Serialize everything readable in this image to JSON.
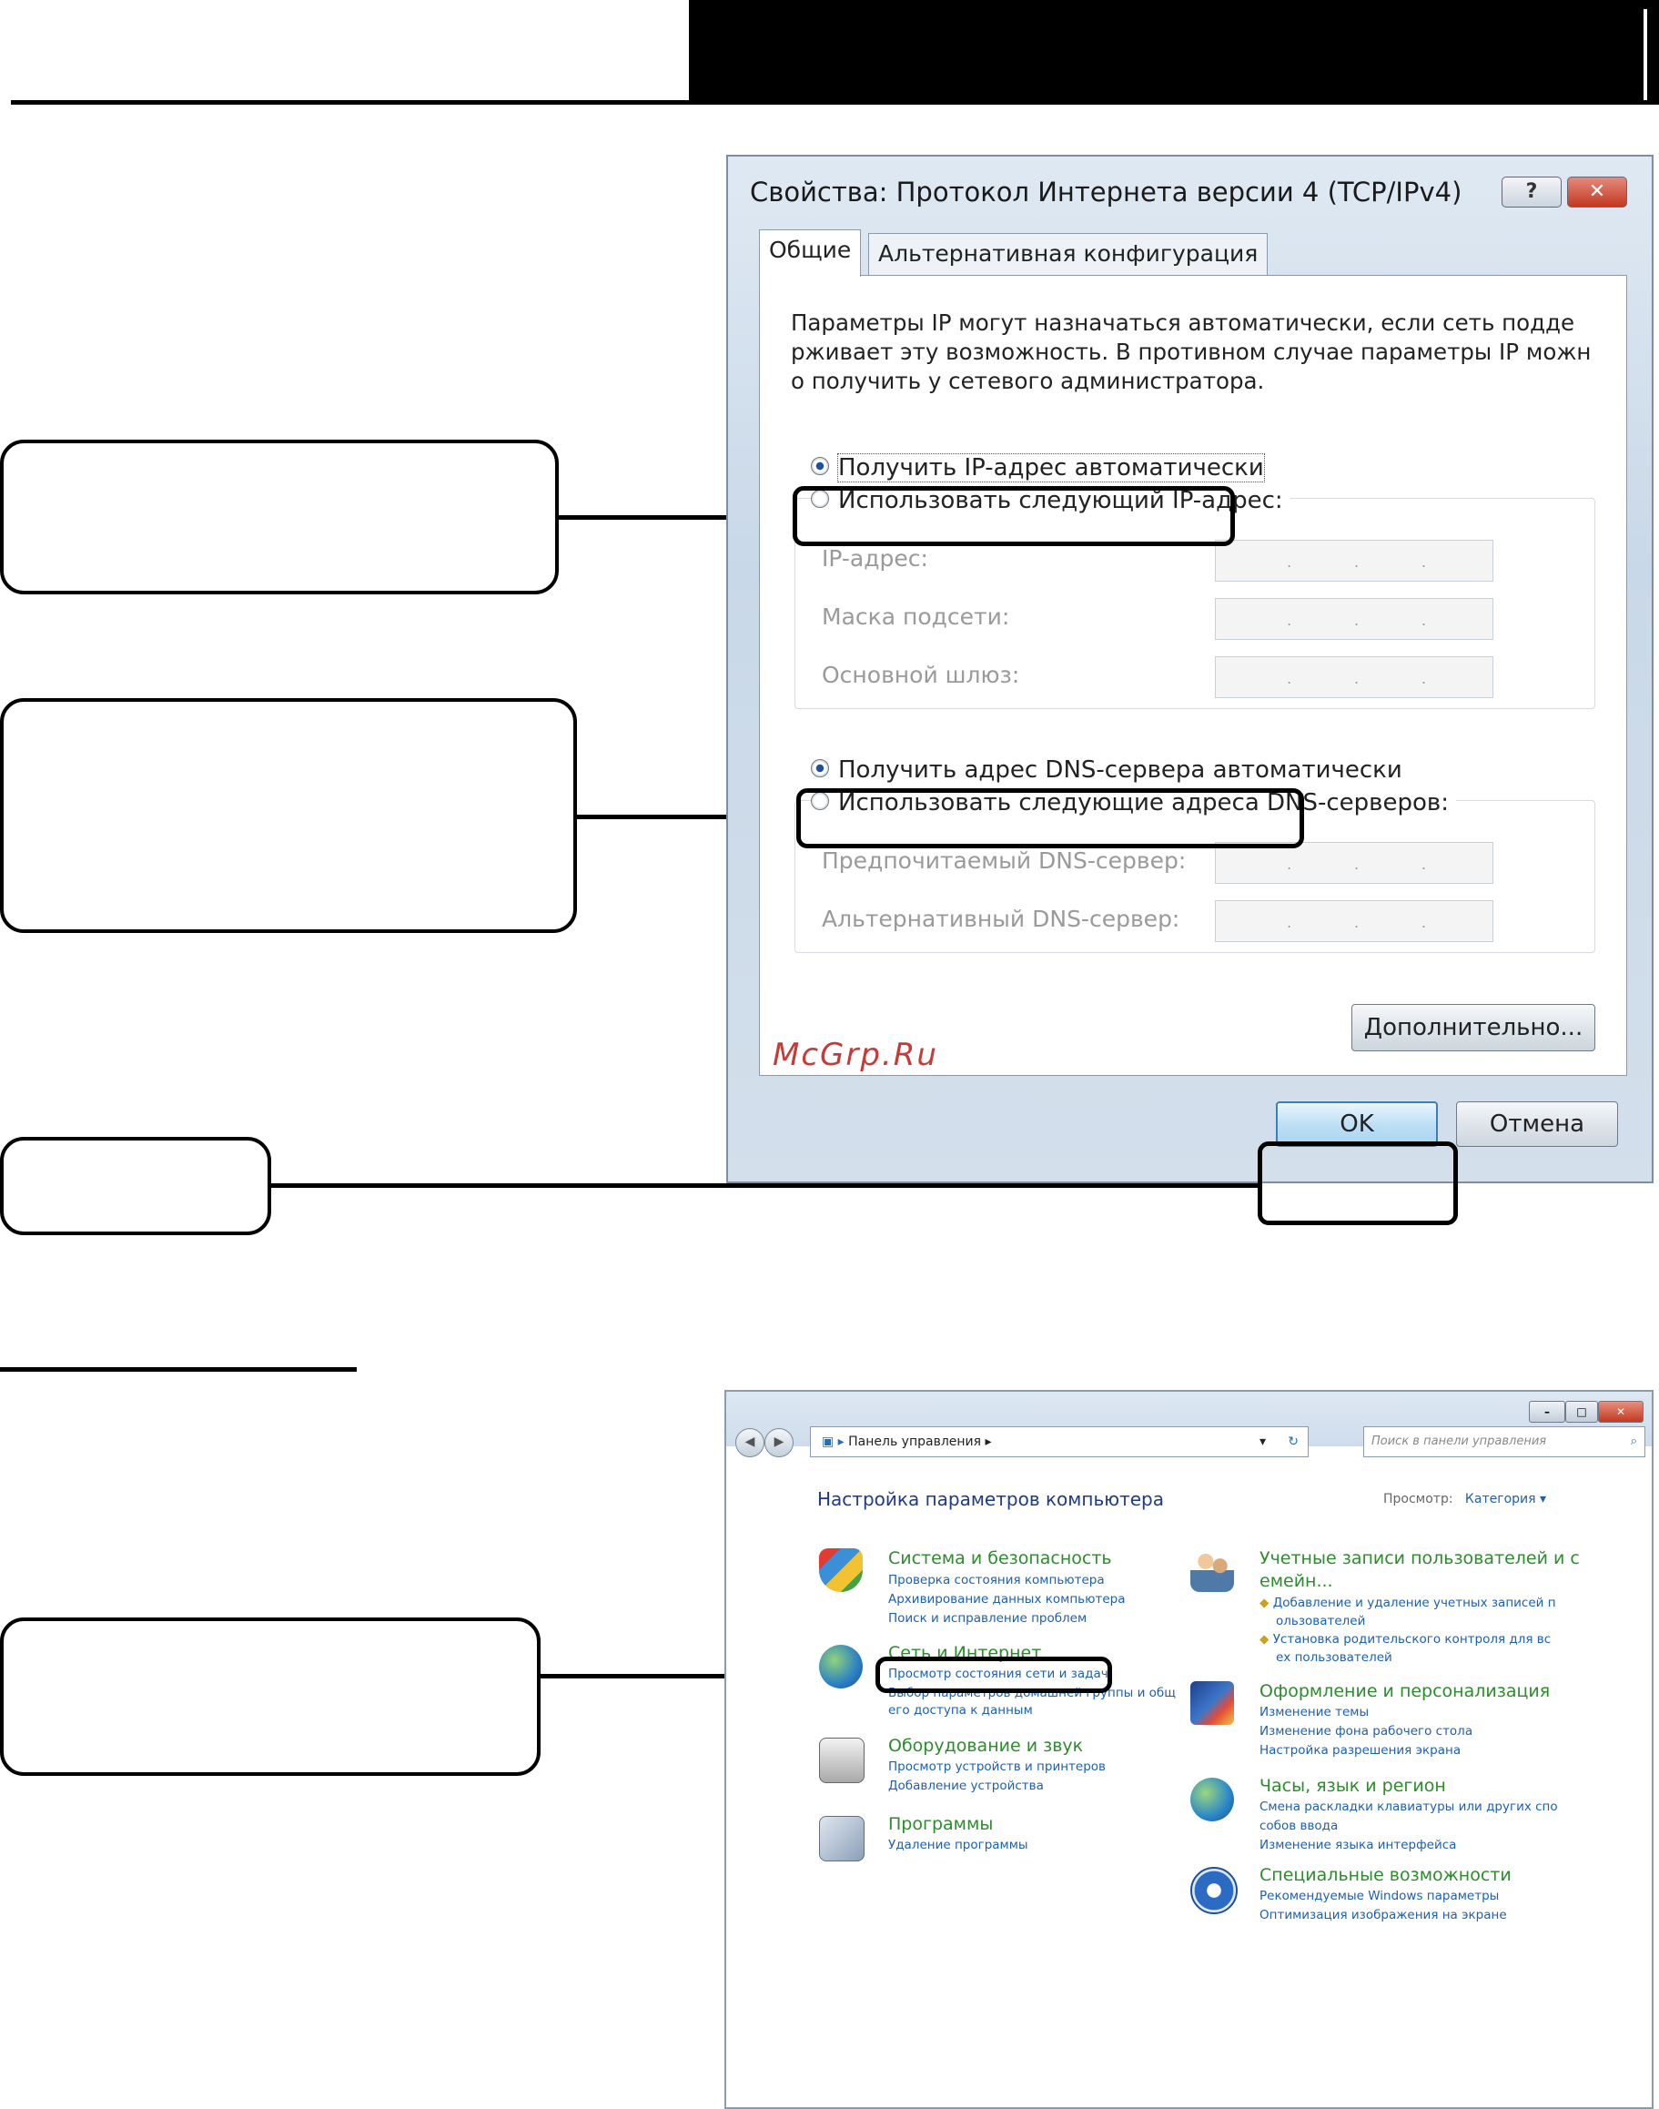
{
  "dialog": {
    "title": "Свойства: Протокол Интернета версии 4 (TCP/IPv4)",
    "help_button": "?",
    "close_button": "✕",
    "tabs": [
      "Общие",
      "Альтернативная конфигурация"
    ],
    "description": "Параметры IP могут назначаться автоматически, если сеть подде ржживает эту возможность. В противном случае параметры IP можн о получить у сетевого администратора.",
    "description_lines": [
      "Параметры IP могут назначаться автоматически, если сеть подде",
      "рживает эту возможность. В противном случае параметры IP можн",
      "о получить у сетевого администратора."
    ],
    "radio_ip_auto": "Получить IP-адрес автоматически",
    "radio_ip_manual": "Использовать следующий IP-адрес:",
    "ip_fields": [
      "IP-адрес:",
      "Маска подсети:",
      "Основной шлюз:"
    ],
    "radio_dns_auto": "Получить адрес DNS-сервера автоматически",
    "radio_dns_manual": "Использовать следующие адреса DNS-серверов:",
    "dns_fields": [
      "Предпочитаемый DNS-сервер:",
      "Альтернативный DNS-сервер:"
    ],
    "advanced_button": "Дополнительно...",
    "ok_button": "OK",
    "cancel_button": "Отмена"
  },
  "watermark": "McGrp.Ru",
  "control_panel": {
    "window_controls": [
      "–",
      "□",
      "✕"
    ],
    "address": "Панель управления",
    "search_placeholder": "Поиск в панели управления",
    "heading": "Настройка параметров компьютера",
    "view_label": "Просмотр:",
    "view_value": "Категория",
    "left_categories": [
      {
        "title": "Система и безопасность",
        "icon": "shield-icon",
        "links": [
          "Проверка состояния компьютера",
          "Архивирование данных компьютера",
          "Поиск и исправление проблем"
        ]
      },
      {
        "title": "Сеть и Интернет",
        "icon": "network-globe-icon",
        "links": [
          "Просмотр состояния сети и задач",
          "Выбор параметров домашней группы и общ",
          "его доступа к данным"
        ]
      },
      {
        "title": "Оборудование и звук",
        "icon": "printer-icon",
        "links": [
          "Просмотр устройств и принтеров",
          "Добавление устройства"
        ]
      },
      {
        "title": "Программы",
        "icon": "programs-icon",
        "links": [
          "Удаление программы"
        ]
      }
    ],
    "right_categories": [
      {
        "title": "Учетные записи пользователей и с",
        "title2": "емейн...",
        "icon": "users-icon",
        "links": [
          "Добавление и удаление учетных записей п",
          "ользователей",
          "Установка родительского контроля для вс",
          "ех пользователей"
        ]
      },
      {
        "title": "Оформление и персонализация",
        "icon": "personalization-icon",
        "links": [
          "Изменение темы",
          "Изменение фона рабочего стола",
          "Настройка разрешения экрана"
        ]
      },
      {
        "title": "Часы, язык и регион",
        "icon": "clock-globe-icon",
        "links": [
          "Смена раскладки клавиатуры или других спо",
          "собов ввода",
          "Изменение языка интерфейса"
        ]
      },
      {
        "title": "Специальные возможности",
        "icon": "accessibility-icon",
        "links": [
          "Рекомендуемые Windows параметры",
          "Оптимизация изображения на экране"
        ]
      }
    ]
  }
}
